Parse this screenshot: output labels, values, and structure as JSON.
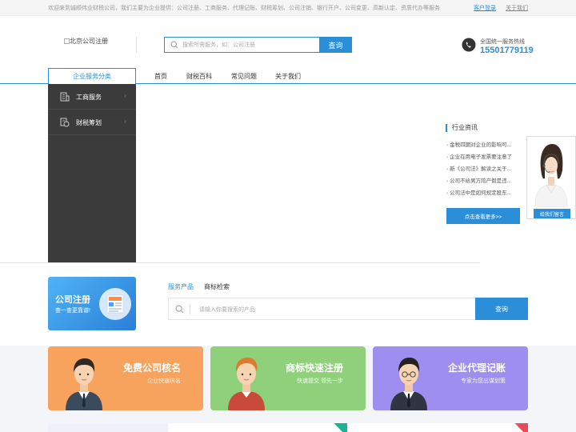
{
  "topbar": {
    "welcome": "欢迎来到诚顺伟业财税公司，我们主要为企业提供：公司注册、工商服务、代理记账、财税筹划、公司注销、银行开户、公司变更、高新认定、资质代办等服务",
    "login": "客户登录",
    "about": "关于我们"
  },
  "logo": {
    "alt": "北京公司注册"
  },
  "search": {
    "placeholder": "搜索所需服务，如：公司注册",
    "button": "查询"
  },
  "hotline": {
    "label": "全国统一服务热线",
    "number": "15501779119"
  },
  "nav": {
    "category": "企业服务分类",
    "items": [
      "首页",
      "财税百科",
      "常见问题",
      "关于我们"
    ]
  },
  "sidemenu": {
    "items": [
      {
        "label": "工商服务",
        "icon": "building-icon"
      },
      {
        "label": "财税筹划",
        "icon": "finance-icon"
      }
    ]
  },
  "news": {
    "title": "行业资讯",
    "items": [
      "金税四期对企业的影响可...",
      "企业在用电子发票要注意了",
      "新《公司法》解读之关于...",
      "公司不给男方陪产假是违...",
      "公司法中是如何规定股东..."
    ],
    "more": "点击查看更多>>"
  },
  "cs": {
    "button": "给我们留言"
  },
  "register_banner": {
    "title": "公司注册",
    "subtitle": "查一查更靠谱!"
  },
  "product_search": {
    "tabs": [
      "服务产品",
      "商标检索"
    ],
    "placeholder": "请输入你要搜索的产品",
    "button": "查询"
  },
  "promos": [
    {
      "title": "免费公司核名",
      "subtitle": "企业快速核名",
      "color": "#f7a25d"
    },
    {
      "title": "商标快速注册",
      "subtitle": "快速提交 领先一步",
      "color": "#8fd07a"
    },
    {
      "title": "企业代理记账",
      "subtitle": "专家为您出谋划策",
      "color": "#9d8ef0"
    }
  ],
  "ribbons": [
    {
      "color": "#19b394"
    },
    {
      "color": "#e94b58"
    }
  ]
}
